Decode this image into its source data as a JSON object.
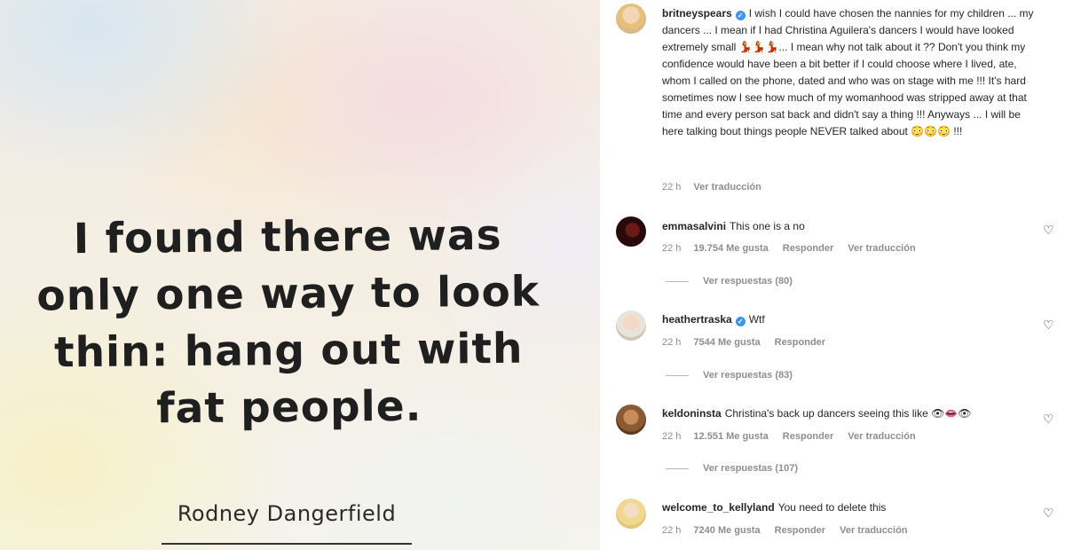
{
  "quote_image": {
    "quote": "I found there was only one way to look thin: hang out with fat people.",
    "author": "Rodney Dangerfield"
  },
  "caption": {
    "username": "britneyspears",
    "text": "I wish I could have chosen the nannies for my children ... my dancers ... I mean if I had Christina Aguilera's dancers I would have looked extremely small 💃💃💃... I mean why not talk about it ?? Don't you think my confidence would have been a bit better if I could choose where I lived, ate, whom I called on the phone, dated and who was on stage with me !!! It's hard sometimes now I see how much of my womanhood was stripped away at that time and every person sat back and didn't say a thing !!! Anyways ... I will be here talking bout things people NEVER talked about 😳😳😳 !!!",
    "time": "22 h",
    "translate": "Ver traducción"
  },
  "comments": [
    {
      "username": "emmasalvini",
      "text": "This one is a no",
      "time": "22 h",
      "likes": "19.754 Me gusta",
      "reply": "Responder",
      "translate": "Ver traducción",
      "replies": "Ver respuestas (80)"
    },
    {
      "username": "heathertraska",
      "text": "Wtf",
      "time": "22 h",
      "likes": "7544 Me gusta",
      "reply": "Responder",
      "replies": "Ver respuestas (83)"
    },
    {
      "username": "keldoninsta",
      "text": "Christina's back up dancers seeing this like 👁👄👁",
      "time": "22 h",
      "likes": "12.551 Me gusta",
      "reply": "Responder",
      "translate": "Ver traducción",
      "replies": "Ver respuestas (107)"
    },
    {
      "username": "welcome_to_kellyland",
      "text": "You need to delete this",
      "time": "22 h",
      "likes": "7240 Me gusta",
      "reply": "Responder",
      "translate": "Ver traducción"
    }
  ],
  "icons": {
    "verified": "verified-badge-icon",
    "heart": "heart-icon"
  },
  "colors": {
    "verified": "#3897f0",
    "meta_text": "#8e8e8e"
  }
}
